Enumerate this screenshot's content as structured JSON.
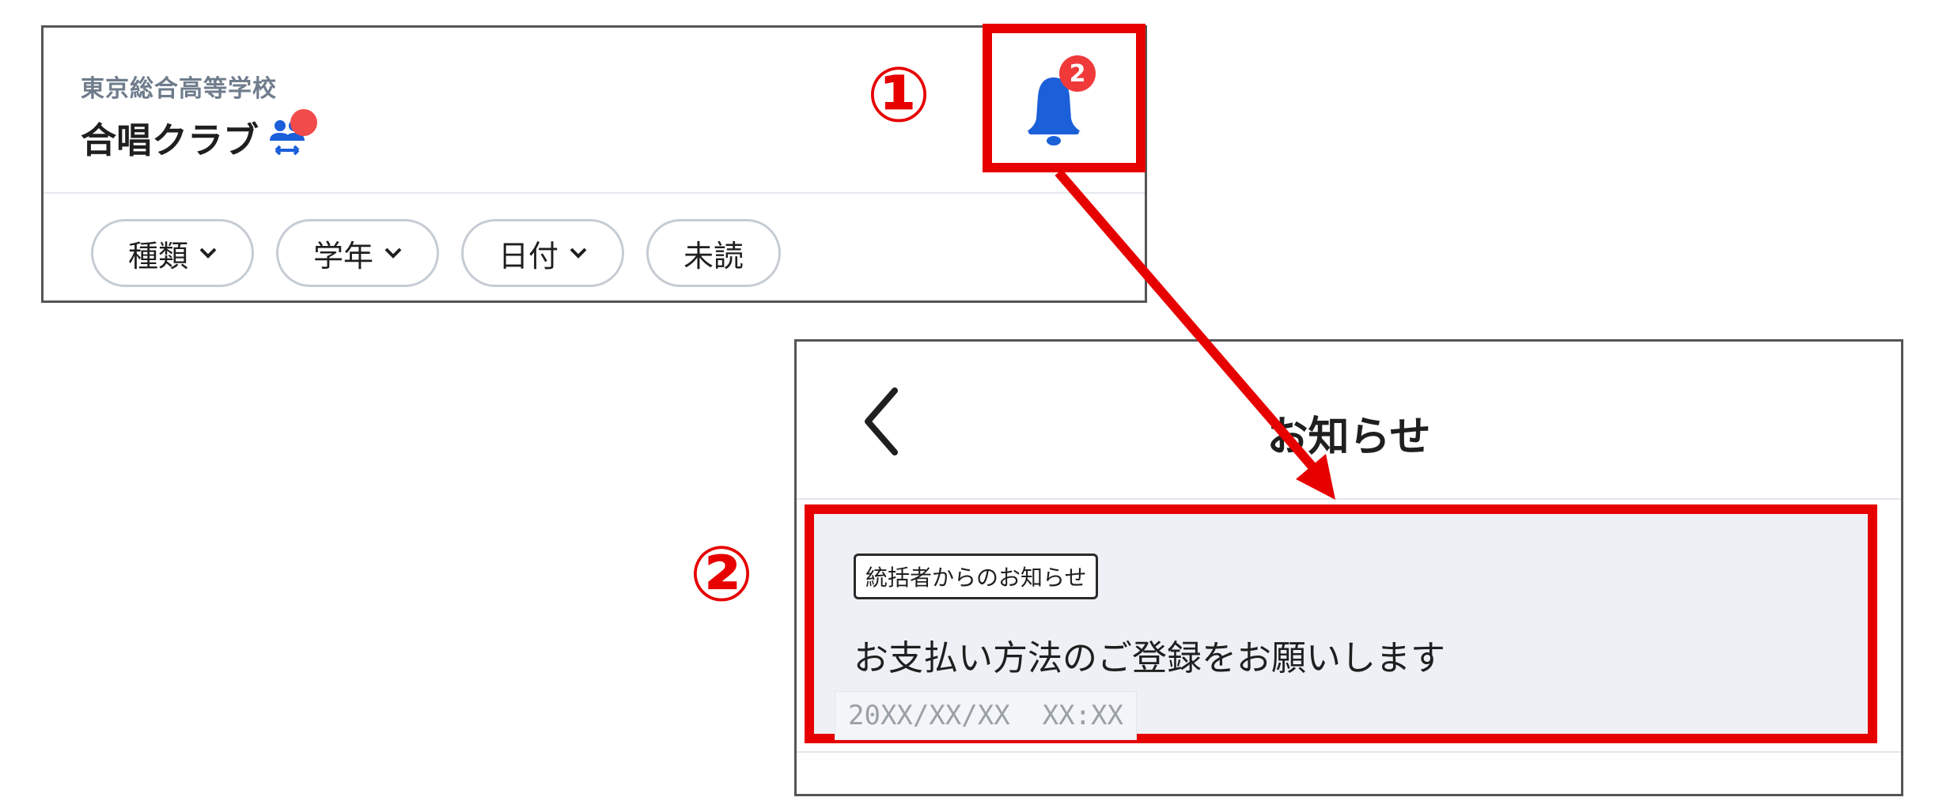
{
  "club_header": {
    "school_name": "東京総合高等学校",
    "club_name": "合唱クラブ",
    "filters": [
      {
        "label": "種類",
        "has_dropdown": true
      },
      {
        "label": "学年",
        "has_dropdown": true
      },
      {
        "label": "日付",
        "has_dropdown": true
      },
      {
        "label": "未読",
        "has_dropdown": false
      }
    ],
    "bell_badge_count": "2",
    "icons": [
      "people-swap-icon",
      "bell-icon"
    ]
  },
  "annotations": {
    "step1": "①",
    "step2": "②",
    "highlight_color": "#e60000"
  },
  "notifications_screen": {
    "title": "お知らせ",
    "items": [
      {
        "tag": "統括者からのお知らせ",
        "message": "お支払い方法のご登録をお願いします",
        "timestamp": "20XX/XX/XX  XX:XX"
      }
    ]
  },
  "colors": {
    "bell_blue": "#1b5fd9",
    "badge_red": "#f03a3a",
    "notice_bg": "#edf1f6"
  }
}
